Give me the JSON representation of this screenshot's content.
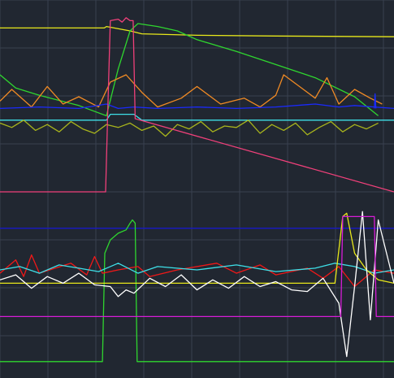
{
  "colors": {
    "background": "#212731",
    "grid": "#394150",
    "yellow": "#e8e81a",
    "green": "#2fd62f",
    "orange": "#f08a24",
    "blue": "#1a2aff",
    "cyan": "#3ee0e8",
    "olive": "#a8b41c",
    "red": "#f01818",
    "magenta": "#d81cd8",
    "pink": "#f0407a",
    "white": "#ffffff",
    "navy": "#1818c8"
  },
  "chart_data": [
    {
      "type": "line",
      "panel": "top",
      "grid": true,
      "ylim": [
        0,
        100
      ],
      "x_range": [
        0,
        100
      ],
      "series": [
        {
          "key": "yellow",
          "color": "yellow",
          "x": [
            0,
            26.5,
            27,
            33,
            36,
            50,
            70,
            100
          ],
          "y": [
            92,
            92,
            93,
            90,
            88,
            87,
            86.5,
            86
          ]
        },
        {
          "key": "green",
          "color": "green",
          "x": [
            0,
            4,
            10,
            20,
            27,
            30,
            33,
            35,
            40,
            45,
            50,
            60,
            70,
            80,
            90,
            96
          ],
          "y": [
            60,
            51,
            46,
            39,
            32,
            64,
            90,
            95,
            93,
            90,
            84,
            76,
            67,
            58,
            45,
            32
          ]
        },
        {
          "key": "orange",
          "color": "orange",
          "x": [
            0,
            3,
            8,
            12,
            16,
            20,
            25,
            28,
            32,
            36,
            40,
            46,
            50,
            56,
            62,
            66,
            70,
            72,
            76,
            80,
            83,
            86,
            90,
            94,
            97
          ],
          "y": [
            42,
            50,
            38,
            52,
            40,
            45,
            38,
            55,
            60,
            48,
            38,
            44,
            52,
            40,
            44,
            38,
            46,
            60,
            52,
            44,
            58,
            40,
            50,
            44,
            40
          ]
        },
        {
          "key": "blue",
          "color": "blue",
          "x": [
            0,
            10,
            20,
            27,
            30,
            34,
            40,
            50,
            60,
            70,
            80,
            86,
            90,
            95,
            100
          ],
          "y": [
            37,
            38,
            37,
            40,
            37,
            38,
            37,
            38,
            37,
            38,
            40,
            38,
            39,
            38,
            37
          ]
        },
        {
          "key": "cyan",
          "color": "cyan",
          "x": [
            0,
            10,
            20,
            27,
            28,
            34,
            36,
            50,
            70,
            90,
            95,
            100
          ],
          "y": [
            29,
            29,
            29,
            29,
            33,
            33,
            29,
            29,
            29,
            29,
            29,
            29
          ]
        },
        {
          "key": "olive",
          "color": "olive",
          "x": [
            0,
            3,
            6,
            9,
            12,
            15,
            18,
            21,
            24,
            27,
            30,
            33,
            36,
            39,
            42,
            45,
            48,
            51,
            54,
            57,
            60,
            63,
            66,
            69,
            72,
            75,
            78,
            81,
            84,
            87,
            90,
            93,
            96
          ],
          "y": [
            27,
            24,
            29,
            22,
            26,
            21,
            28,
            23,
            20,
            26,
            24,
            27,
            22,
            25,
            18,
            26,
            23,
            28,
            21,
            25,
            24,
            29,
            20,
            26,
            22,
            27,
            19,
            24,
            28,
            21,
            26,
            23,
            27
          ]
        },
        {
          "key": "pink",
          "color": "pink",
          "x": [
            0,
            26.8,
            27.3,
            28,
            30,
            31,
            32,
            33,
            33.8,
            34.3,
            100
          ],
          "y": [
            -20,
            -20,
            30,
            97,
            98,
            96,
            99,
            97,
            97,
            30,
            -20
          ]
        },
        {
          "key": "blue-spike",
          "color": "blue",
          "x": [
            95,
            95.2,
            95.4
          ],
          "y": [
            37,
            47,
            37
          ]
        }
      ]
    },
    {
      "type": "line",
      "panel": "bottom",
      "grid": true,
      "ylim": [
        0,
        100
      ],
      "x_range": [
        0,
        100
      ],
      "series": [
        {
          "key": "navy",
          "color": "navy",
          "x": [
            0,
            100
          ],
          "y": [
            85,
            85
          ]
        },
        {
          "key": "green",
          "color": "green",
          "x": [
            0,
            26,
            26.6,
            28,
            30,
            32,
            33,
            33.6,
            34.3,
            34.8,
            100
          ],
          "y": [
            5,
            5,
            70,
            78,
            82,
            84,
            88,
            90,
            88,
            5,
            5
          ]
        },
        {
          "key": "red",
          "color": "red",
          "x": [
            0,
            4,
            6,
            8,
            10,
            14,
            18,
            22,
            24,
            26,
            30,
            35,
            38,
            45,
            55,
            60,
            66,
            70,
            78,
            82,
            86,
            90,
            95,
            100
          ],
          "y": [
            58,
            66,
            56,
            69,
            58,
            61,
            64,
            57,
            68,
            58,
            60,
            62,
            56,
            60,
            64,
            58,
            63,
            57,
            61,
            55,
            62,
            50,
            60,
            58
          ]
        },
        {
          "key": "cyan",
          "color": "cyan",
          "x": [
            0,
            5,
            10,
            15,
            20,
            25,
            30,
            35,
            40,
            50,
            60,
            70,
            80,
            85,
            90,
            95,
            100
          ],
          "y": [
            60,
            62,
            58,
            63,
            61,
            59,
            64,
            58,
            62,
            60,
            63,
            59,
            61,
            64,
            62,
            58,
            60
          ]
        },
        {
          "key": "yellow",
          "color": "yellow",
          "x": [
            0,
            10,
            20,
            30,
            40,
            50,
            60,
            70,
            80,
            85,
            87,
            88,
            90,
            93,
            96,
            100
          ],
          "y": [
            52,
            52,
            52,
            52,
            52,
            52,
            52,
            52,
            52,
            52,
            92,
            94,
            70,
            60,
            54,
            52
          ]
        },
        {
          "key": "white",
          "color": "white",
          "x": [
            0,
            4,
            8,
            12,
            16,
            20,
            24,
            28,
            30,
            32,
            34,
            38,
            42,
            46,
            50,
            54,
            58,
            62,
            66,
            70,
            74,
            78,
            82,
            86,
            88,
            90,
            92,
            94,
            96,
            100
          ],
          "y": [
            54,
            57,
            49,
            56,
            52,
            58,
            51,
            50,
            44,
            48,
            46,
            55,
            50,
            57,
            48,
            54,
            49,
            56,
            50,
            53,
            48,
            47,
            55,
            40,
            8,
            50,
            95,
            30,
            90,
            52
          ]
        },
        {
          "key": "magenta",
          "color": "magenta",
          "x": [
            0,
            86.5,
            87,
            95,
            95.5,
            100
          ],
          "y": [
            32,
            32,
            92,
            92,
            32,
            32
          ]
        }
      ]
    }
  ]
}
